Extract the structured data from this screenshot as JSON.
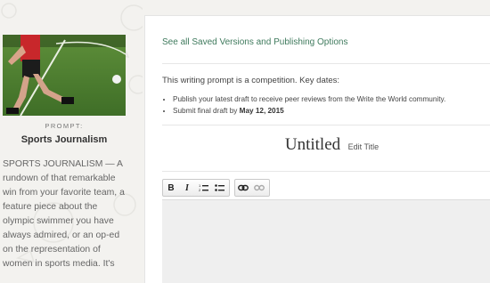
{
  "sidebar": {
    "prompt_label": "PROMPT:",
    "prompt_title": "Sports Journalism",
    "description_lines": [
      "SPORTS JOURNALISM — A",
      "rundown of that remarkable",
      "win from your favorite team, a",
      "feature piece about the",
      "olympic swimmer you have",
      "always admired, or an op-ed",
      "on the representation of",
      "women in sports media. It's"
    ]
  },
  "main": {
    "saved_versions_link": "See all Saved Versions and Publishing Options",
    "competition_intro": "This writing prompt is a competition. Key dates:",
    "key_dates": {
      "item1": "Publish your latest draft to receive peer reviews from the Write the World community.",
      "item2_prefix": "Submit final draft by ",
      "item2_date": "May 12, 2015"
    },
    "doc_title": "Untitled",
    "edit_title_label": "Edit Title"
  },
  "toolbar": {
    "bold": "B",
    "italic": "I",
    "numbered_list": "numbered-list-icon",
    "bulleted_list": "bulleted-list-icon",
    "link": "link-icon",
    "unlink": "unlink-icon"
  },
  "colors": {
    "link_green": "#3f7a5d",
    "page_bg": "#f3f2ef",
    "editor_bg": "#efefef"
  }
}
